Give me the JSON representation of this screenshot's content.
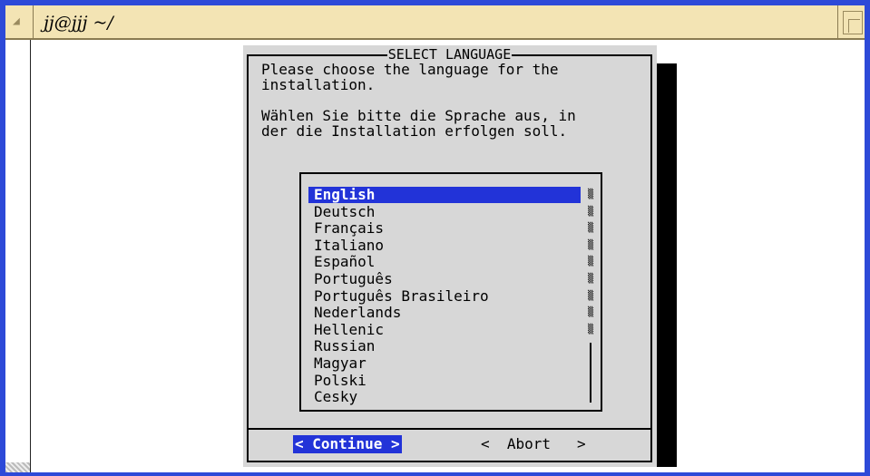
{
  "window": {
    "title": "jj@jjj ~/"
  },
  "dialog": {
    "title": "SELECT LANGUAGE",
    "text": "Please choose the language for the\ninstallation.\n\nWählen Sie bitte die Sprache aus, in\nder die Installation erfolgen soll.",
    "languages": [
      "English",
      "Deutsch",
      "Français",
      "Italiano",
      "Español",
      "Português",
      "Português Brasileiro",
      "Nederlands",
      "Hellenic",
      "Russian",
      "Magyar",
      "Polski",
      "Cesky"
    ],
    "selected_index": 0,
    "continue_label": "< Continue >",
    "abort_label": "<  Abort   >"
  },
  "colors": {
    "frame": "#2d4ad8",
    "titlebar": "#f3e4b4",
    "dialog_bg": "#d7d7d7",
    "selection": "#2233d8"
  }
}
